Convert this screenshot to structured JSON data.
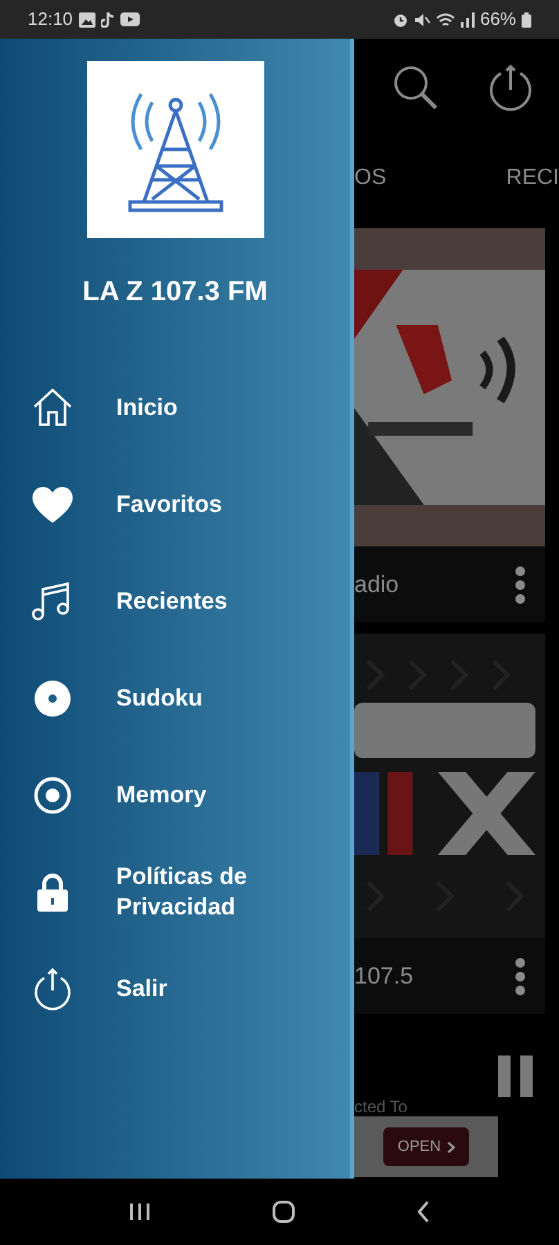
{
  "status_bar": {
    "time": "12:10",
    "battery": "66%"
  },
  "drawer": {
    "title": "LA Z 107.3 FM",
    "items": [
      {
        "label": "Inicio",
        "kind": "home"
      },
      {
        "label": "Favoritos",
        "kind": "heart"
      },
      {
        "label": "Recientes",
        "kind": "music"
      },
      {
        "label": "Sudoku",
        "kind": "disc"
      },
      {
        "label": "Memory",
        "kind": "target"
      },
      {
        "label": "Políticas de Privacidad",
        "kind": "lock"
      },
      {
        "label": "Salir",
        "kind": "power"
      }
    ]
  },
  "tabs": [
    {
      "label": "OS"
    },
    {
      "label": "RECI"
    }
  ],
  "stations": [
    {
      "name": "adio",
      "kind": "picture"
    },
    {
      "name": "107.5",
      "kind": "picture"
    }
  ],
  "player": {
    "status": "cted To"
  },
  "ad": {
    "button": "OPEN"
  }
}
